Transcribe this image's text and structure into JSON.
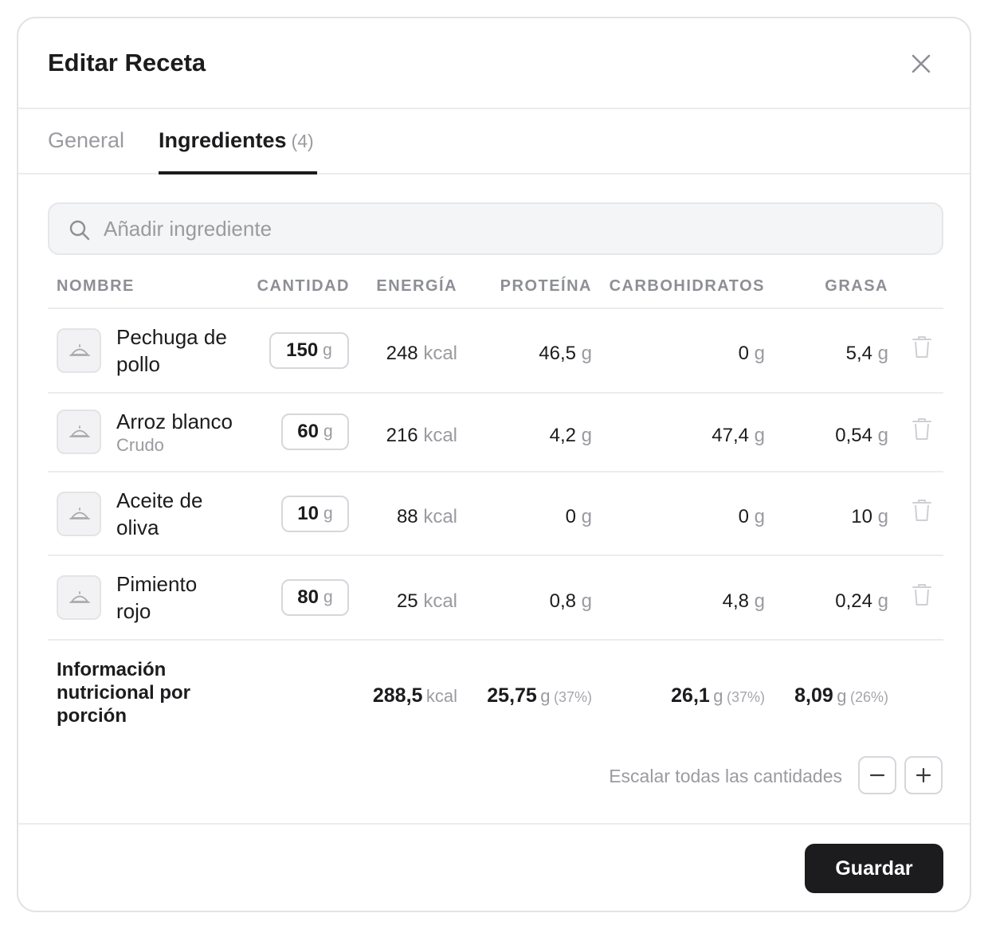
{
  "dialog": {
    "title": "Editar Receta"
  },
  "tabs": [
    {
      "label": "General",
      "active": false
    },
    {
      "label": "Ingredientes",
      "count": "(4)",
      "active": true
    }
  ],
  "search": {
    "placeholder": "Añadir ingrediente",
    "value": ""
  },
  "table": {
    "headers": {
      "name": "NOMBRE",
      "quantity": "CANTIDAD",
      "energy": "ENERGÍA",
      "protein": "PROTEÍNA",
      "carbs": "CARBOHIDRATOS",
      "fat": "GRASA"
    },
    "rows": [
      {
        "name": "Pechuga de pollo",
        "sub": "",
        "qty": "150",
        "qty_unit": "g",
        "energy": "248",
        "energy_unit": "kcal",
        "protein": "46,5",
        "carbs": "0",
        "fat": "5,4",
        "unit": "g"
      },
      {
        "name": "Arroz blanco",
        "sub": "Crudo",
        "qty": "60",
        "qty_unit": "g",
        "energy": "216",
        "energy_unit": "kcal",
        "protein": "4,2",
        "carbs": "47,4",
        "fat": "0,54",
        "unit": "g"
      },
      {
        "name": "Aceite de oliva",
        "sub": "",
        "qty": "10",
        "qty_unit": "g",
        "energy": "88",
        "energy_unit": "kcal",
        "protein": "0",
        "carbs": "0",
        "fat": "10",
        "unit": "g"
      },
      {
        "name": "Pimiento rojo",
        "sub": "",
        "qty": "80",
        "qty_unit": "g",
        "energy": "25",
        "energy_unit": "kcal",
        "protein": "0,8",
        "carbs": "4,8",
        "fat": "0,24",
        "unit": "g"
      }
    ]
  },
  "summary": {
    "label": "Información nutricional por porción",
    "energy": "288,5",
    "energy_unit": "kcal",
    "protein": "25,75",
    "protein_unit": "g",
    "protein_pct": "(37%)",
    "carbs": "26,1",
    "carbs_unit": "g",
    "carbs_pct": "(37%)",
    "fat": "8,09",
    "fat_unit": "g",
    "fat_pct": "(26%)"
  },
  "scale": {
    "label": "Escalar todas las cantidades"
  },
  "footer": {
    "save_label": "Guardar"
  },
  "icons": {
    "close": "close-icon",
    "search": "search-icon",
    "thumb": "cloche-icon",
    "trash": "trash-icon",
    "minus": "minus-icon",
    "plus": "plus-icon"
  },
  "colors": {
    "primary": "#1c1c1e",
    "muted": "#9a9ba0",
    "border": "#e3e3e6"
  }
}
